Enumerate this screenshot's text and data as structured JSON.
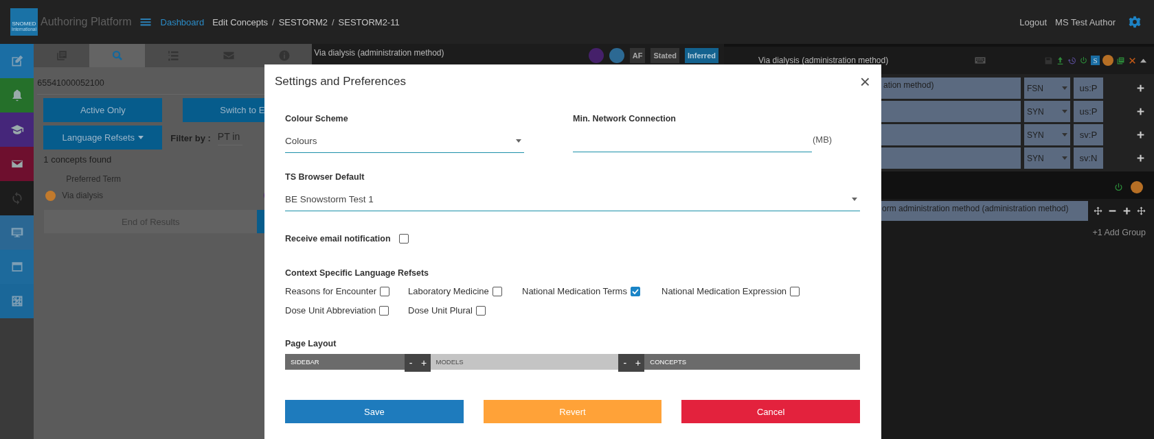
{
  "header": {
    "logo": {
      "name": "SNOMED",
      "sub": "International"
    },
    "app_title": "Authoring Platform",
    "breadcrumb": {
      "separator": "/",
      "items": [
        {
          "label": "Dashboard",
          "kind": "link"
        },
        {
          "label": "Edit Concepts",
          "kind": "text"
        },
        {
          "label": "SESTORM2",
          "kind": "text"
        },
        {
          "label": "SESTORM2-11",
          "kind": "text"
        }
      ]
    },
    "links": [
      "Logout",
      "MS Test Author"
    ]
  },
  "rail": [
    {
      "kind": "edit",
      "color": "#1b6ea4"
    },
    {
      "kind": "bell",
      "color": "#25702a"
    },
    {
      "kind": "cap",
      "color": "#45267a"
    },
    {
      "kind": "mail",
      "color": "#6e0f2e"
    },
    {
      "kind": "sync",
      "color": "#1c1c1c"
    },
    {
      "kind": "monitor",
      "color": "#2b6793"
    },
    {
      "kind": "window",
      "color": "#1d6a9c"
    },
    {
      "kind": "grid",
      "color": "#1a6799"
    }
  ],
  "search_panel": {
    "tabs": [
      {
        "kind": "list",
        "selected": false
      },
      {
        "kind": "search",
        "selected": true
      },
      {
        "kind": "numbered",
        "selected": false
      },
      {
        "kind": "mail",
        "selected": false
      },
      {
        "kind": "info",
        "selected": false
      }
    ],
    "concept_id": "65541000052100",
    "buttons": [
      "Active Only",
      "Switch to E"
    ],
    "refset_dropdown": "Language Refsets",
    "filter_label": "Filter by :",
    "filter_value": "PT in",
    "result_count": "1 concepts found",
    "column": "Preferred Term",
    "results": [
      {
        "term": "Via dialysis",
        "color": "#c27a2c"
      }
    ],
    "end_label": "End of Results"
  },
  "concept_panel": {
    "title": "Via dialysis (administration method)",
    "views": [
      {
        "label": "AF",
        "selected": false
      },
      {
        "label": "Stated",
        "selected": false
      },
      {
        "label": "Inferred",
        "selected": true
      }
    ]
  },
  "edit_panel": {
    "title": "Via dialysis (administration method)",
    "descriptions": [
      {
        "term": "ation method)",
        "type": "FSN",
        "language": "us:P"
      },
      {
        "type": "SYN",
        "language": "us:P"
      },
      {
        "type": "SYN",
        "language": "sv:P"
      },
      {
        "type": "SYN",
        "language": "sv:N"
      }
    ],
    "relationship": "orm administration method (administration method)",
    "add_group": "+1 Add Group",
    "badge": "S"
  },
  "dialog": {
    "title": "Settings and Preferences",
    "close": "×",
    "colour_scheme": {
      "label": "Colour Scheme",
      "value": "Colours"
    },
    "network": {
      "label": "Min. Network Connection",
      "unit": "(MB)"
    },
    "ts_browser": {
      "label": "TS Browser Default",
      "value": "BE Snowstorm Test 1"
    },
    "email": {
      "label": "Receive email notification",
      "checked": false
    },
    "refsets": {
      "label": "Context Specific Language Refsets",
      "items": [
        {
          "label": "Reasons for Encounter",
          "checked": false
        },
        {
          "label": "Laboratory Medicine",
          "checked": false
        },
        {
          "label": "National Medication Terms",
          "checked": true
        },
        {
          "label": "National Medication Expression",
          "checked": false
        },
        {
          "label": "Dose Unit Abbreviation",
          "checked": false
        },
        {
          "label": "Dose Unit Plural",
          "checked": false
        }
      ]
    },
    "layout": {
      "label": "Page Layout",
      "segments": [
        {
          "label": "SIDEBAR",
          "color": "#6b6b6b"
        },
        {
          "label": "MODELS",
          "color": "#c4c4c4"
        },
        {
          "label": "CONCEPTS",
          "color": "#6b6b6b"
        }
      ],
      "resizers": [
        {
          "minus": "-",
          "plus": "+"
        },
        {
          "minus": "-",
          "plus": "+"
        }
      ]
    },
    "buttons": [
      {
        "label": "Save",
        "kind": "save"
      },
      {
        "label": "Revert",
        "kind": "revert"
      },
      {
        "label": "Cancel",
        "kind": "cancel"
      }
    ]
  }
}
